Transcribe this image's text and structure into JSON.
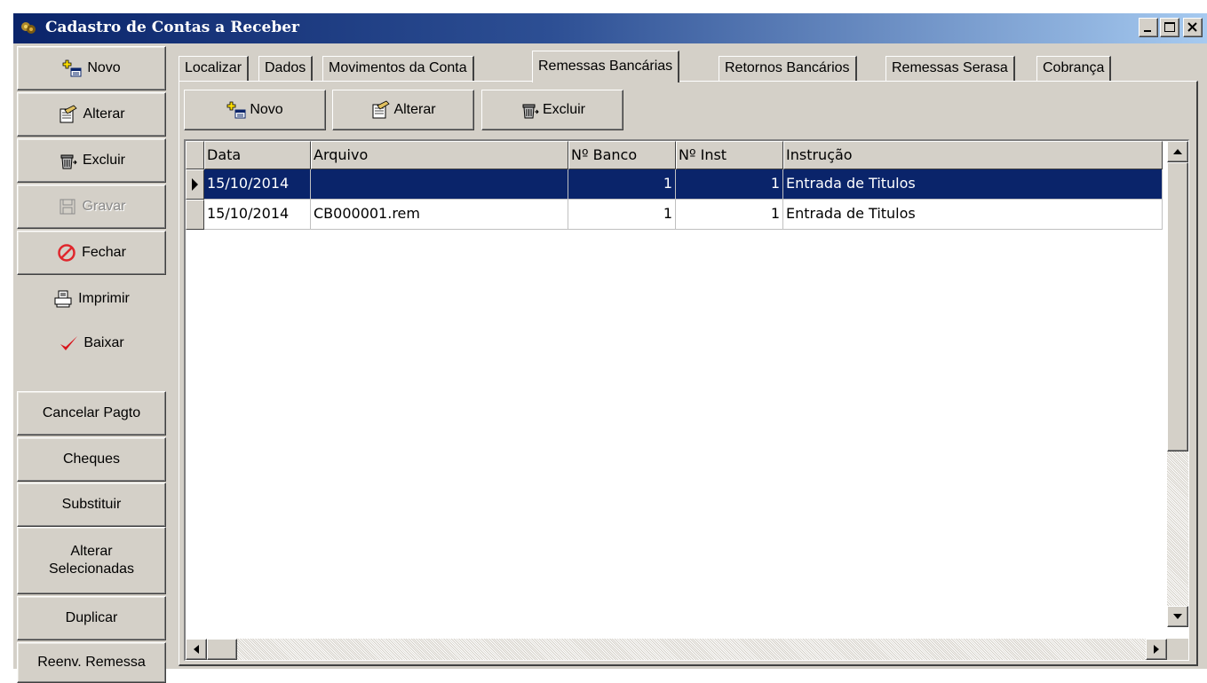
{
  "window": {
    "title": "Cadastro de Contas a Receber",
    "icon": "app-icon",
    "controls": [
      "_",
      "□",
      "×"
    ]
  },
  "sidebar": {
    "buttons": [
      {
        "label": "Novo",
        "icon": "new-doc-icon",
        "enabled": true
      },
      {
        "label": "Alterar",
        "icon": "edit-doc-icon",
        "enabled": true
      },
      {
        "label": "Excluir",
        "icon": "trash-icon",
        "enabled": true
      },
      {
        "label": "Gravar",
        "icon": "save-icon",
        "enabled": false
      },
      {
        "label": "Fechar",
        "icon": "no-entry-icon",
        "enabled": true
      },
      {
        "label": "Imprimir",
        "icon": "printer-icon",
        "enabled": true
      },
      {
        "label": "Baixar",
        "icon": "checkmark-icon",
        "enabled": true
      },
      {
        "label": "Cancelar Pagto",
        "enabled": true
      },
      {
        "label": "Cheques",
        "enabled": true
      },
      {
        "label": "Substituir",
        "enabled": true
      },
      {
        "label": "Alterar\nSelecionadas",
        "enabled": true
      },
      {
        "label": "Duplicar",
        "enabled": true
      },
      {
        "label": "Reenv. Remessa",
        "enabled": true
      }
    ]
  },
  "tabs": [
    {
      "label": "Localizar",
      "active": false
    },
    {
      "label": "Dados",
      "active": false
    },
    {
      "label": "Movimentos da Conta",
      "active": false
    },
    {
      "label": "Remessas Bancárias",
      "active": true
    },
    {
      "label": "Retornos Bancários",
      "active": false
    },
    {
      "label": "Remessas Serasa",
      "active": false
    },
    {
      "label": "Cobrança",
      "active": false
    }
  ],
  "toolbar": {
    "novo_label": "Novo",
    "alterar_label": "Alterar",
    "excluir_label": "Excluir"
  },
  "grid": {
    "columns": [
      "Data",
      "Arquivo",
      "Nº Banco",
      "Nº Inst",
      "Instrução"
    ],
    "rows": [
      {
        "data": "15/10/2014",
        "arquivo": "",
        "banco": "1",
        "inst": "1",
        "instrucao": "Entrada de Titulos",
        "selected": true
      },
      {
        "data": "15/10/2014",
        "arquivo": "CB000001.rem",
        "banco": "1",
        "inst": "1",
        "instrucao": "Entrada de Titulos",
        "selected": false
      }
    ]
  },
  "colors": {
    "selection": "#0a246a",
    "face": "#d4d0c8",
    "fechar_icon": "#e0262c",
    "baixar_icon": "#d8151c"
  }
}
